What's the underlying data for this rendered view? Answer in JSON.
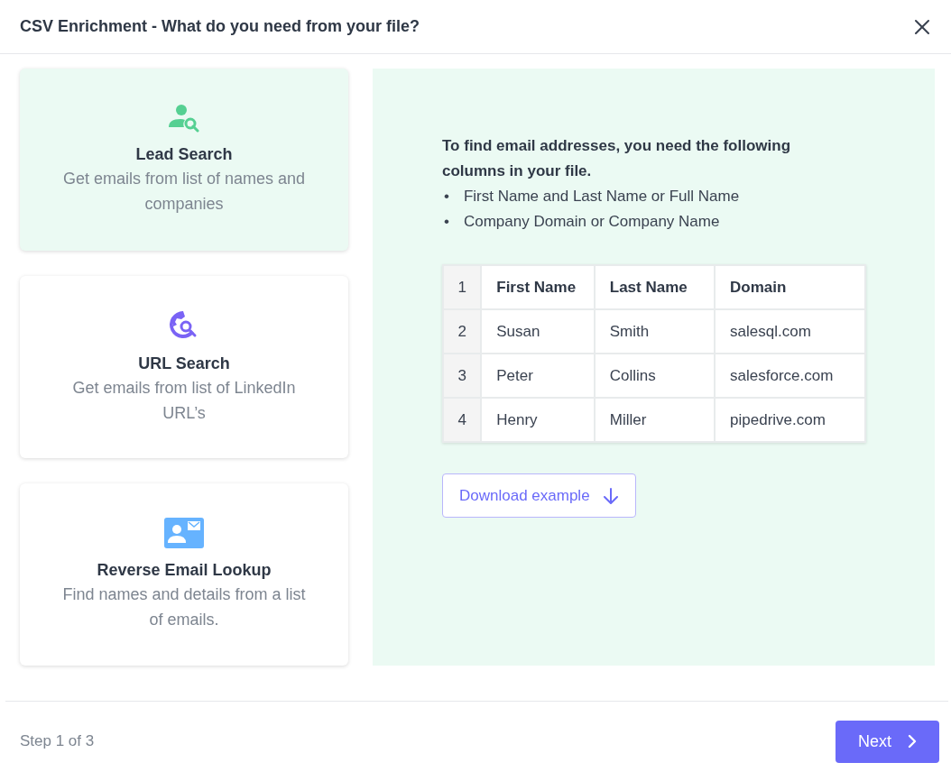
{
  "dialog": {
    "title": "CSV Enrichment - What do you need from your file?"
  },
  "options": [
    {
      "kind": "lead",
      "title": "Lead Search",
      "description": "Get emails from list of names and companies",
      "selected": true
    },
    {
      "kind": "url",
      "title": "URL Search",
      "description": "Get emails from list of LinkedIn URL’s",
      "selected": false
    },
    {
      "kind": "email",
      "title": "Reverse Email Lookup",
      "description": "Find names and details from a list of emails.",
      "selected": false
    }
  ],
  "details": {
    "intro": "To find email addresses, you need the following columns in your file.",
    "requirements": [
      {
        "bullet": "•",
        "text": "First Name and Last Name or Full Name"
      },
      {
        "bullet": "•",
        "text": "Company Domain or Company Name"
      }
    ],
    "table": {
      "header": {
        "number": "1",
        "cells": [
          "First Name",
          "Last Name",
          "Domain"
        ]
      },
      "rows": [
        {
          "number": "2",
          "cells": [
            "Susan",
            "Smith",
            "salesql.com"
          ]
        },
        {
          "number": "3",
          "cells": [
            "Peter",
            "Collins",
            "salesforce.com"
          ]
        },
        {
          "number": "4",
          "cells": [
            "Henry",
            "Miller",
            "pipedrive.com"
          ]
        }
      ]
    },
    "download_button": "Download example"
  },
  "footer": {
    "step": "Step 1 of 3",
    "next_button": "Next"
  }
}
